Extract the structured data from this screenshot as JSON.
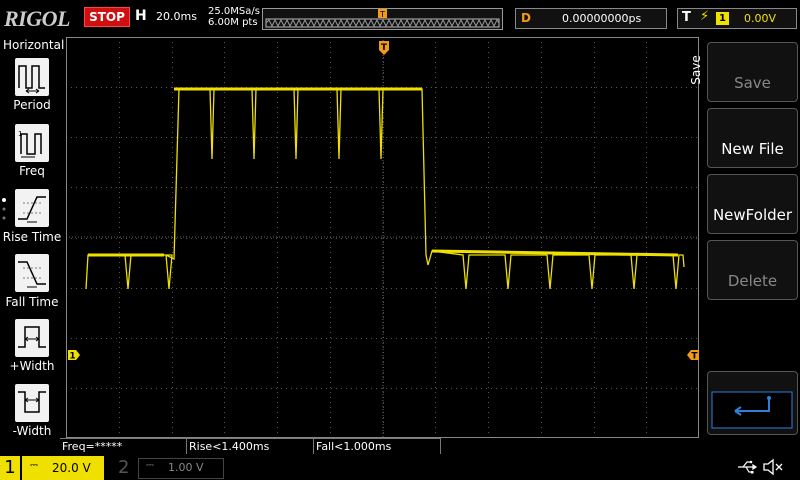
{
  "brand": "RIGOL",
  "run_status": "STOP",
  "horizontal": {
    "letter": "H",
    "timebase": "20.0ms",
    "sample_rate": "25.0MSa/s",
    "memory_depth": "6.00M pts"
  },
  "delay": {
    "letter": "D",
    "value": "0.00000000ps"
  },
  "trigger": {
    "letter": "T",
    "source": "1",
    "level": "0.00V",
    "marker": "T"
  },
  "left_menu": {
    "title": "Horizontal",
    "items": [
      {
        "label": "Period",
        "icon": "period-icon"
      },
      {
        "label": "Freq",
        "icon": "frequency-icon"
      },
      {
        "label": "Rise Time",
        "icon": "rise-time-icon"
      },
      {
        "label": "Fall Time",
        "icon": "fall-time-icon"
      },
      {
        "label": "+Width",
        "icon": "positive-width-icon"
      },
      {
        "label": "-Width",
        "icon": "negative-width-icon"
      }
    ]
  },
  "right_menu": {
    "title": "Save",
    "buttons": [
      {
        "label": "Save",
        "enabled": false
      },
      {
        "label": "New File",
        "enabled": true
      },
      {
        "label": "NewFolder",
        "enabled": true
      },
      {
        "label": "Delete",
        "enabled": false
      }
    ],
    "return_icon": "return-arrow-icon"
  },
  "measurements": [
    "Freq=*****",
    "Rise<1.400ms",
    "Fall<1.000ms"
  ],
  "channels": [
    {
      "number": "1",
      "coupling": "DC",
      "scale": "20.0 V",
      "active": true,
      "color": "#f0e000"
    },
    {
      "number": "2",
      "coupling": "DC",
      "scale": "1.00 V",
      "active": false,
      "color": "#555555"
    }
  ],
  "ch1_marker": "1",
  "trigger_level_marker": "T",
  "colors": {
    "trace": "#f0e000",
    "trigger_marker": "#f39c12",
    "stop": "#d01010",
    "grid": "#555555"
  },
  "icons": [
    "usb-icon",
    "speaker-mute-icon"
  ]
}
